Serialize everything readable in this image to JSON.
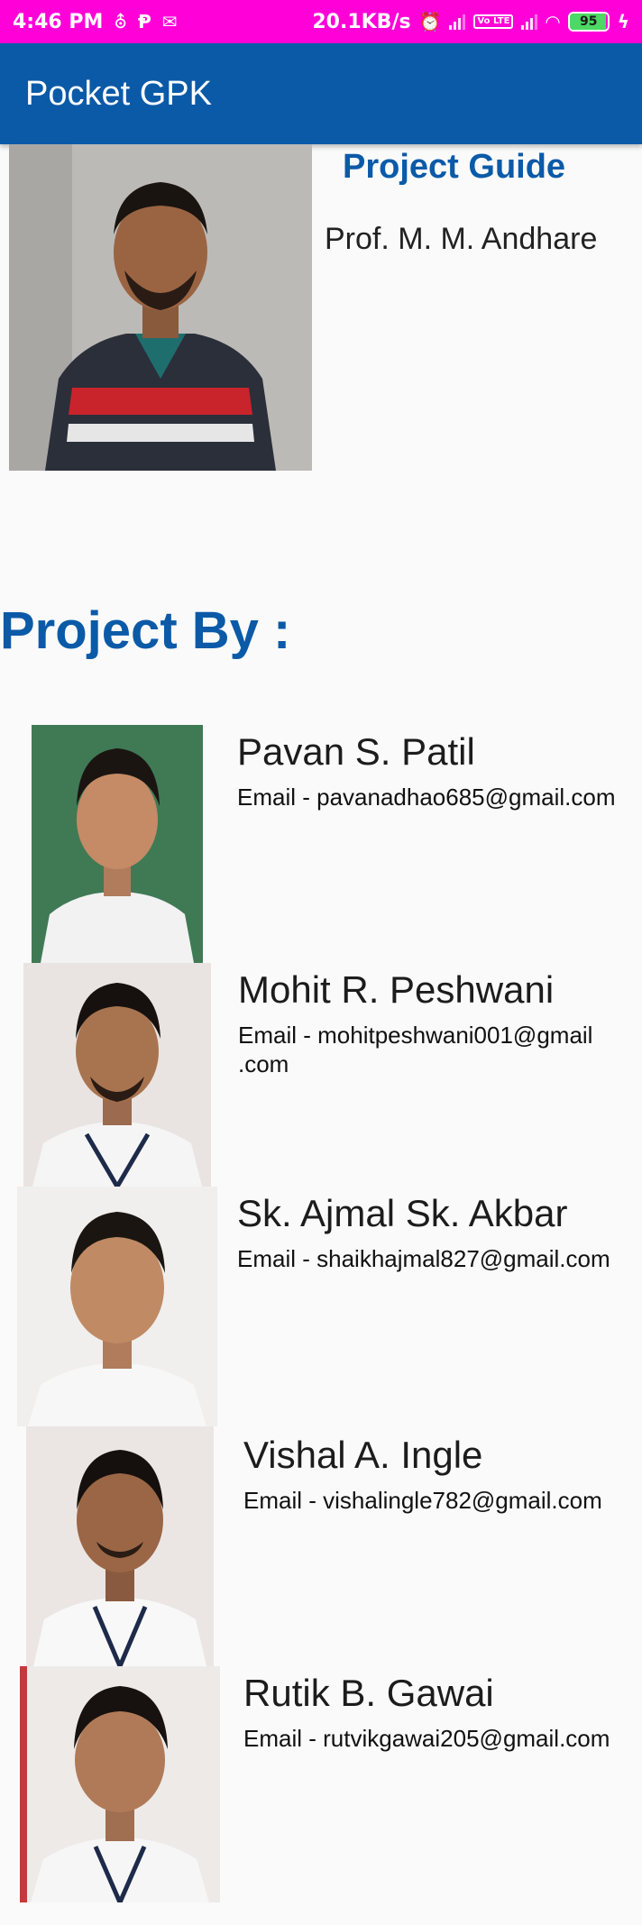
{
  "status_bar": {
    "time": "4:46 PM",
    "left_icons": [
      "usb-icon",
      "p-app-icon",
      "gmail-icon"
    ],
    "network_speed": "20.1KB/s",
    "volte_label": "Vo LTE",
    "battery_level": "95",
    "right_icons": [
      "alarm-icon",
      "signal-icon",
      "volte-icon",
      "signal-icon",
      "wifi-icon",
      "battery-icon",
      "charging-icon"
    ],
    "color": "#ff00d8"
  },
  "app_bar": {
    "title": "Pocket GPK",
    "color": "#0b5aa8"
  },
  "guide": {
    "heading": "Project Guide",
    "name": "Prof. M. M. Andhare"
  },
  "project_by": {
    "heading": "Project By :"
  },
  "members": [
    {
      "name": "Pavan S. Patil",
      "email": "Email - pavanadhao685@gmail.com"
    },
    {
      "name": "Mohit R. Peshwani",
      "email": "Email - mohitpeshwani001@gmail\n.com"
    },
    {
      "name": "Sk. Ajmal Sk. Akbar",
      "email": "Email - shaikhajmal827@gmail.com"
    },
    {
      "name": "Vishal A. Ingle",
      "email": "Email - vishalingle782@gmail.com"
    },
    {
      "name": "Rutik B. Gawai",
      "email": "Email - rutvikgawai205@gmail.com"
    }
  ],
  "accent_color": "#0b5aa8"
}
